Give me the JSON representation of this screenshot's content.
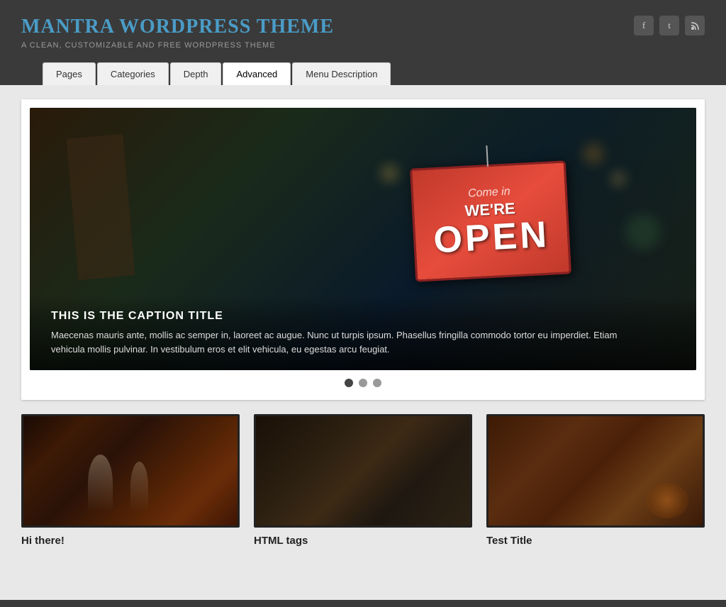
{
  "site": {
    "title": "Mantra WordPress Theme",
    "tagline": "A Clean, Customizable and Free WordPress Theme"
  },
  "social": {
    "icons": [
      "f",
      "t",
      "rss"
    ]
  },
  "nav": {
    "tabs": [
      {
        "label": "Pages",
        "active": false
      },
      {
        "label": "Categories",
        "active": false
      },
      {
        "label": "Depth",
        "active": false
      },
      {
        "label": "Advanced",
        "active": true
      },
      {
        "label": "Menu Description",
        "active": false
      }
    ]
  },
  "slider": {
    "caption_title": "This is the Caption Title",
    "caption_text": "Maecenas mauris ante, mollis ac semper in, laoreet ac augue. Nunc ut turpis ipsum. Phasellus fringilla commodo tortor eu imperdiet. Etiam vehicula mollis pulvinar. In vestibulum eros et elit vehicula, eu egestas arcu feugiat.",
    "dots": [
      {
        "active": true
      },
      {
        "active": false
      },
      {
        "active": false
      }
    ]
  },
  "cards": [
    {
      "title": "Hi there!"
    },
    {
      "title": "HTML tags"
    },
    {
      "title": "Test Title"
    }
  ]
}
